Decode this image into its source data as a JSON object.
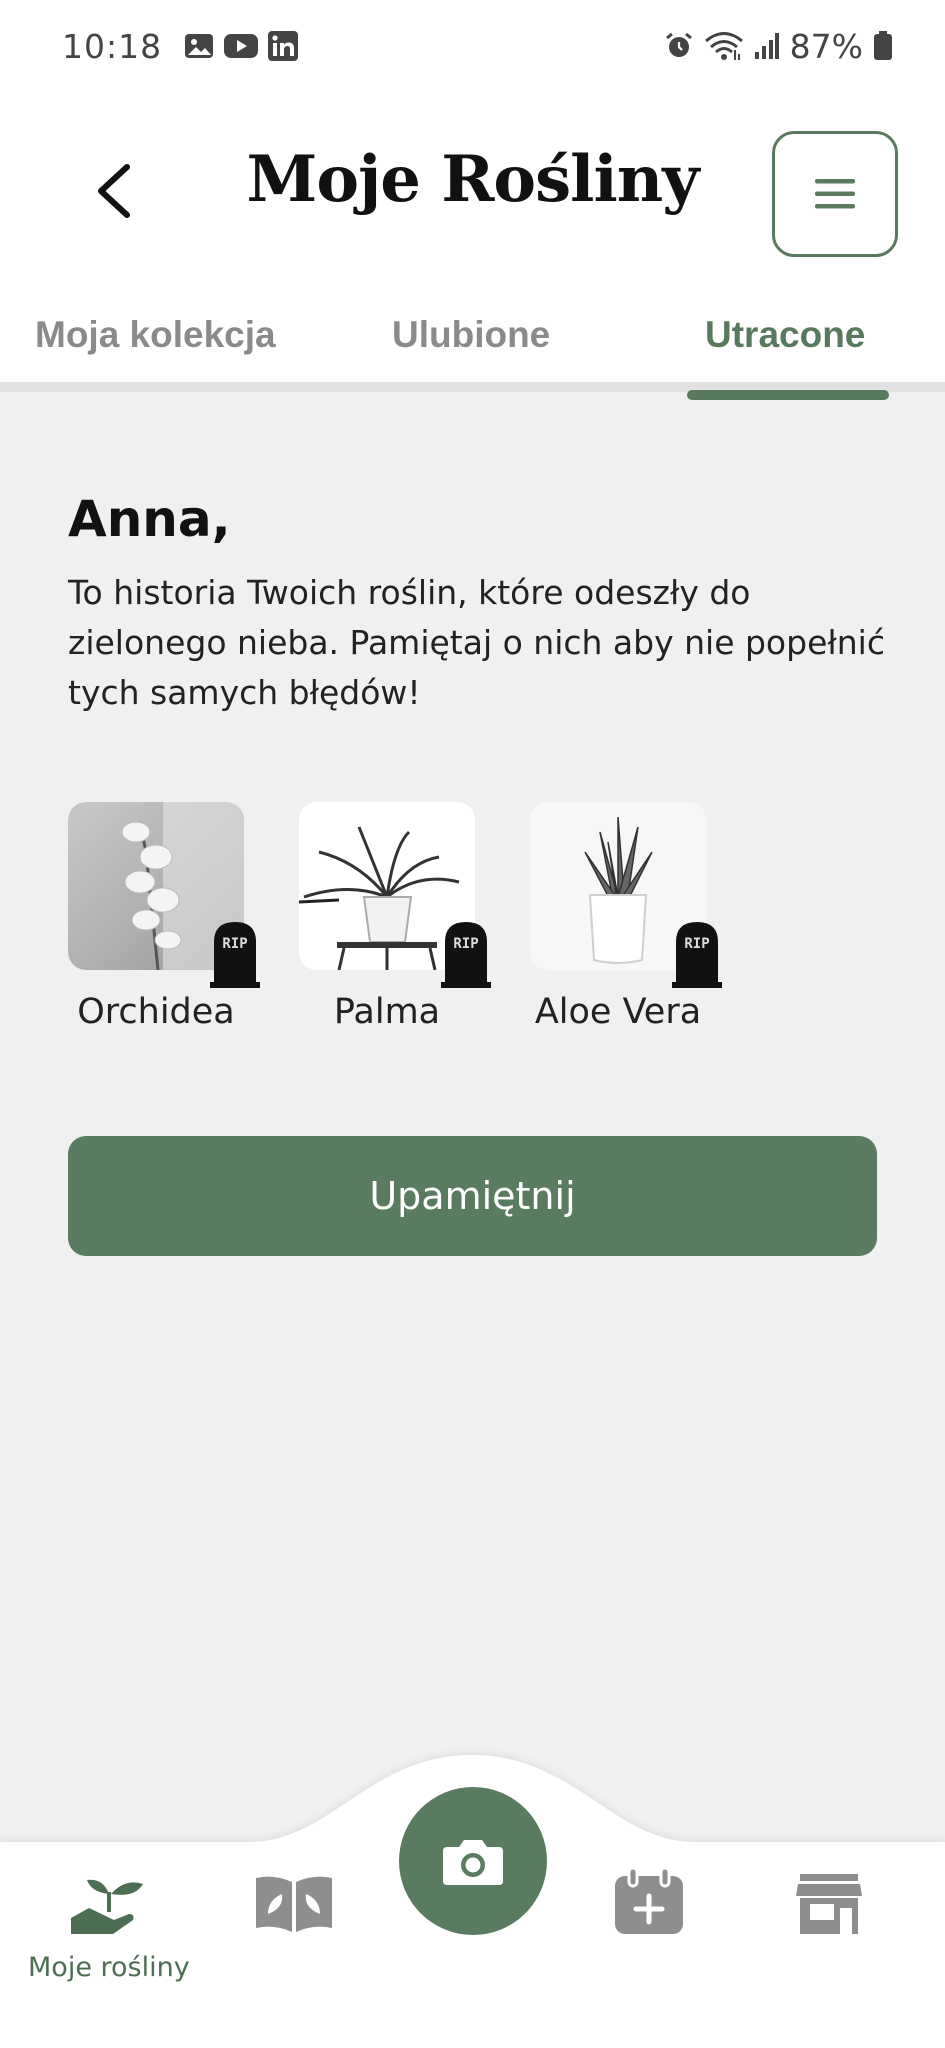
{
  "status_bar": {
    "time": "10:18",
    "battery": "87%",
    "left_icons": [
      "gallery-icon",
      "youtube-icon",
      "linkedin-icon"
    ],
    "right_icons": [
      "alarm-icon",
      "wifi-icon",
      "signal-icon",
      "battery-icon"
    ]
  },
  "header": {
    "title": "Moje Rośliny",
    "back_icon": "chevron-left-icon",
    "menu_icon": "hamburger-menu-icon"
  },
  "tabs": [
    {
      "label": "Moja kolekcja",
      "active": false
    },
    {
      "label": "Ulubione",
      "active": false
    },
    {
      "label": "Utracone",
      "active": true
    }
  ],
  "main": {
    "greeting": "Anna,",
    "intro_lines": [
      "To historia Twoich roślin, które odeszły do",
      "zielonego nieba. Pamiętaj o nich aby nie popełnić",
      "tych samych błędów!"
    ],
    "plants": [
      {
        "name": "Orchidea",
        "badge": "RIP"
      },
      {
        "name": "Palma",
        "badge": "RIP"
      },
      {
        "name": "Aloe Vera",
        "badge": "RIP"
      }
    ],
    "memorial_button": "Upamiętnij"
  },
  "bottom_nav": {
    "items": [
      {
        "label": "Moje rośliny",
        "icon": "plant-hand-icon",
        "active": true
      },
      {
        "label": "",
        "icon": "book-icon",
        "active": false
      },
      {
        "label": "",
        "icon": "camera-icon",
        "active": false
      },
      {
        "label": "",
        "icon": "calendar-add-icon",
        "active": false
      },
      {
        "label": "",
        "icon": "store-icon",
        "active": false
      }
    ]
  },
  "colors": {
    "accent": "#597b5f",
    "background": "#f0f0f0",
    "inactive_icon": "#8e8e8e"
  }
}
